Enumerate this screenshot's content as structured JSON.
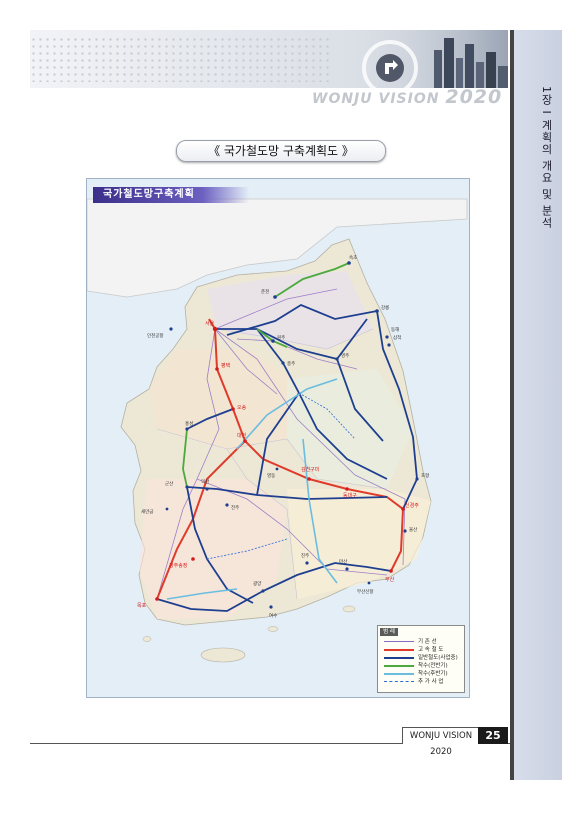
{
  "header": {
    "brand_main": "WONJU VISION",
    "brand_year": "2020"
  },
  "side_tab": {
    "chapter_title": "1장 I 계획의 개요 및 분석"
  },
  "map_caption": "《 국가철도망 구축계획도 》",
  "map": {
    "title": "국가철도망구축계획",
    "legend": {
      "heading": "범 례",
      "items": [
        {
          "label": "기 존 선",
          "color": "#8f6cc3",
          "style": "solid"
        },
        {
          "label": "고 속 철 도",
          "color": "#e03a2a",
          "style": "solid"
        },
        {
          "label": "일반철도(사업중)",
          "color": "#1e3f8f",
          "style": "solid"
        },
        {
          "label": "착수(전반기)",
          "color": "#4caa3c",
          "style": "solid"
        },
        {
          "label": "착수(후반기)",
          "color": "#6bbde0",
          "style": "solid"
        },
        {
          "label": "추 가 사 업",
          "color": "#2e6bd6",
          "style": "dashed"
        }
      ]
    },
    "cities": [
      {
        "name": "서울",
        "hl": true
      },
      {
        "name": "춘천",
        "hl": false
      },
      {
        "name": "속초",
        "hl": false
      },
      {
        "name": "강릉",
        "hl": false
      },
      {
        "name": "동해",
        "hl": false
      },
      {
        "name": "삼척",
        "hl": false
      },
      {
        "name": "원주",
        "hl": false
      },
      {
        "name": "인천공항",
        "hl": false
      },
      {
        "name": "평택",
        "hl": true
      },
      {
        "name": "충주",
        "hl": false
      },
      {
        "name": "영주",
        "hl": false
      },
      {
        "name": "오송",
        "hl": true
      },
      {
        "name": "대전",
        "hl": true
      },
      {
        "name": "김천구미",
        "hl": true
      },
      {
        "name": "동대구",
        "hl": true
      },
      {
        "name": "포항",
        "hl": false
      },
      {
        "name": "신경주",
        "hl": true
      },
      {
        "name": "울산",
        "hl": false
      },
      {
        "name": "부산",
        "hl": true
      },
      {
        "name": "군산",
        "hl": false
      },
      {
        "name": "익산",
        "hl": false
      },
      {
        "name": "전주",
        "hl": false
      },
      {
        "name": "새만금",
        "hl": false
      },
      {
        "name": "광주송정",
        "hl": true
      },
      {
        "name": "목포",
        "hl": true
      },
      {
        "name": "광양",
        "hl": false
      },
      {
        "name": "여수",
        "hl": false
      },
      {
        "name": "진주",
        "hl": false
      },
      {
        "name": "마산",
        "hl": false
      },
      {
        "name": "부산신항",
        "hl": false
      },
      {
        "name": "홍성",
        "hl": false
      },
      {
        "name": "영동",
        "hl": false
      }
    ]
  },
  "footer": {
    "label": "WONJU VISION 2020",
    "page_number": "25"
  },
  "colors": {
    "side_tab": "#cfd6e4",
    "highspeed": "#e03a2a",
    "general": "#1e3f8f",
    "existing": "#8f6cc3",
    "phase1": "#4caa3c",
    "phase2": "#6bbde0"
  }
}
